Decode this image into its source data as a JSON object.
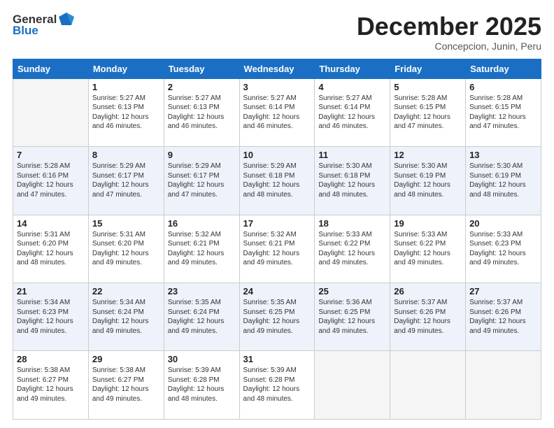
{
  "logo": {
    "general": "General",
    "blue": "Blue"
  },
  "header": {
    "month": "December 2025",
    "location": "Concepcion, Junin, Peru"
  },
  "days_of_week": [
    "Sunday",
    "Monday",
    "Tuesday",
    "Wednesday",
    "Thursday",
    "Friday",
    "Saturday"
  ],
  "weeks": [
    [
      {
        "day": "",
        "info": ""
      },
      {
        "day": "1",
        "info": "Sunrise: 5:27 AM\nSunset: 6:13 PM\nDaylight: 12 hours\nand 46 minutes."
      },
      {
        "day": "2",
        "info": "Sunrise: 5:27 AM\nSunset: 6:13 PM\nDaylight: 12 hours\nand 46 minutes."
      },
      {
        "day": "3",
        "info": "Sunrise: 5:27 AM\nSunset: 6:14 PM\nDaylight: 12 hours\nand 46 minutes."
      },
      {
        "day": "4",
        "info": "Sunrise: 5:27 AM\nSunset: 6:14 PM\nDaylight: 12 hours\nand 46 minutes."
      },
      {
        "day": "5",
        "info": "Sunrise: 5:28 AM\nSunset: 6:15 PM\nDaylight: 12 hours\nand 47 minutes."
      },
      {
        "day": "6",
        "info": "Sunrise: 5:28 AM\nSunset: 6:15 PM\nDaylight: 12 hours\nand 47 minutes."
      }
    ],
    [
      {
        "day": "7",
        "info": "Sunrise: 5:28 AM\nSunset: 6:16 PM\nDaylight: 12 hours\nand 47 minutes."
      },
      {
        "day": "8",
        "info": "Sunrise: 5:29 AM\nSunset: 6:17 PM\nDaylight: 12 hours\nand 47 minutes."
      },
      {
        "day": "9",
        "info": "Sunrise: 5:29 AM\nSunset: 6:17 PM\nDaylight: 12 hours\nand 47 minutes."
      },
      {
        "day": "10",
        "info": "Sunrise: 5:29 AM\nSunset: 6:18 PM\nDaylight: 12 hours\nand 48 minutes."
      },
      {
        "day": "11",
        "info": "Sunrise: 5:30 AM\nSunset: 6:18 PM\nDaylight: 12 hours\nand 48 minutes."
      },
      {
        "day": "12",
        "info": "Sunrise: 5:30 AM\nSunset: 6:19 PM\nDaylight: 12 hours\nand 48 minutes."
      },
      {
        "day": "13",
        "info": "Sunrise: 5:30 AM\nSunset: 6:19 PM\nDaylight: 12 hours\nand 48 minutes."
      }
    ],
    [
      {
        "day": "14",
        "info": "Sunrise: 5:31 AM\nSunset: 6:20 PM\nDaylight: 12 hours\nand 48 minutes."
      },
      {
        "day": "15",
        "info": "Sunrise: 5:31 AM\nSunset: 6:20 PM\nDaylight: 12 hours\nand 49 minutes."
      },
      {
        "day": "16",
        "info": "Sunrise: 5:32 AM\nSunset: 6:21 PM\nDaylight: 12 hours\nand 49 minutes."
      },
      {
        "day": "17",
        "info": "Sunrise: 5:32 AM\nSunset: 6:21 PM\nDaylight: 12 hours\nand 49 minutes."
      },
      {
        "day": "18",
        "info": "Sunrise: 5:33 AM\nSunset: 6:22 PM\nDaylight: 12 hours\nand 49 minutes."
      },
      {
        "day": "19",
        "info": "Sunrise: 5:33 AM\nSunset: 6:22 PM\nDaylight: 12 hours\nand 49 minutes."
      },
      {
        "day": "20",
        "info": "Sunrise: 5:33 AM\nSunset: 6:23 PM\nDaylight: 12 hours\nand 49 minutes."
      }
    ],
    [
      {
        "day": "21",
        "info": "Sunrise: 5:34 AM\nSunset: 6:23 PM\nDaylight: 12 hours\nand 49 minutes."
      },
      {
        "day": "22",
        "info": "Sunrise: 5:34 AM\nSunset: 6:24 PM\nDaylight: 12 hours\nand 49 minutes."
      },
      {
        "day": "23",
        "info": "Sunrise: 5:35 AM\nSunset: 6:24 PM\nDaylight: 12 hours\nand 49 minutes."
      },
      {
        "day": "24",
        "info": "Sunrise: 5:35 AM\nSunset: 6:25 PM\nDaylight: 12 hours\nand 49 minutes."
      },
      {
        "day": "25",
        "info": "Sunrise: 5:36 AM\nSunset: 6:25 PM\nDaylight: 12 hours\nand 49 minutes."
      },
      {
        "day": "26",
        "info": "Sunrise: 5:37 AM\nSunset: 6:26 PM\nDaylight: 12 hours\nand 49 minutes."
      },
      {
        "day": "27",
        "info": "Sunrise: 5:37 AM\nSunset: 6:26 PM\nDaylight: 12 hours\nand 49 minutes."
      }
    ],
    [
      {
        "day": "28",
        "info": "Sunrise: 5:38 AM\nSunset: 6:27 PM\nDaylight: 12 hours\nand 49 minutes."
      },
      {
        "day": "29",
        "info": "Sunrise: 5:38 AM\nSunset: 6:27 PM\nDaylight: 12 hours\nand 49 minutes."
      },
      {
        "day": "30",
        "info": "Sunrise: 5:39 AM\nSunset: 6:28 PM\nDaylight: 12 hours\nand 48 minutes."
      },
      {
        "day": "31",
        "info": "Sunrise: 5:39 AM\nSunset: 6:28 PM\nDaylight: 12 hours\nand 48 minutes."
      },
      {
        "day": "",
        "info": ""
      },
      {
        "day": "",
        "info": ""
      },
      {
        "day": "",
        "info": ""
      }
    ]
  ]
}
